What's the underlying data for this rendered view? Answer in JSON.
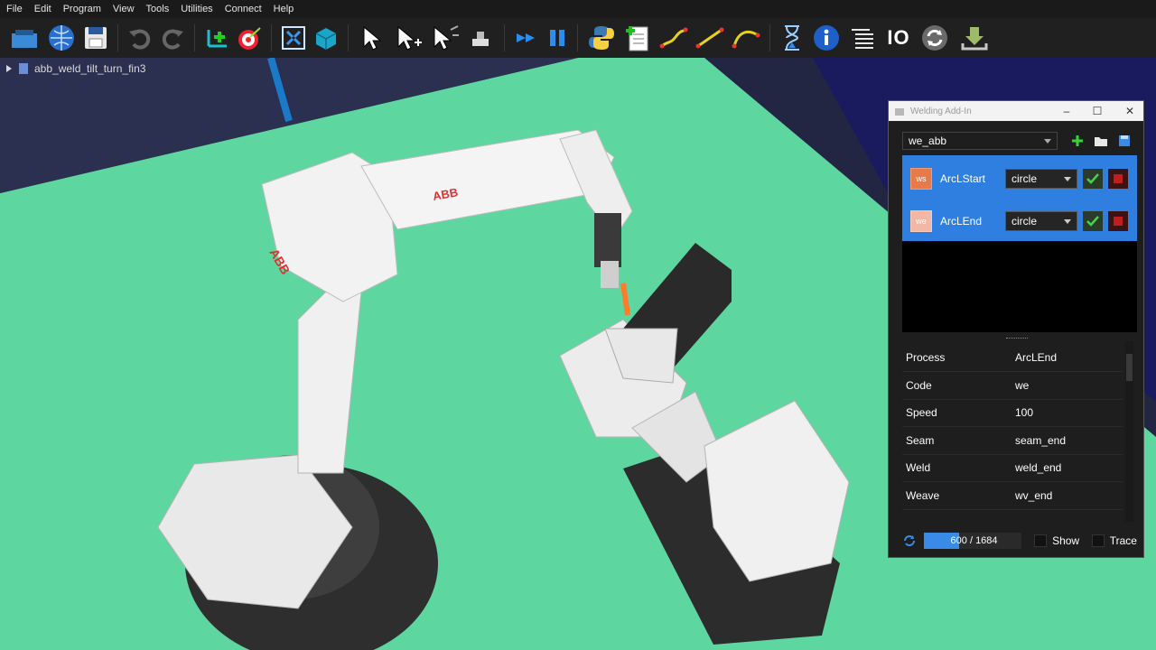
{
  "menu": [
    "File",
    "Edit",
    "Program",
    "View",
    "Tools",
    "Utilities",
    "Connect",
    "Help"
  ],
  "toolbar": {
    "io_label": "IO",
    "icons": [
      "open-station-icon",
      "globe-icon",
      "save-icon",
      "undo-icon",
      "redo-icon",
      "add-frame-icon",
      "target-icon",
      "fit-view-icon",
      "cube-icon",
      "select-icon",
      "select-add-icon",
      "select-move-icon",
      "place-icon",
      "run-icon",
      "pause-icon",
      "python-icon",
      "new-program-icon",
      "path-1-icon",
      "path-2-icon",
      "path-3-icon",
      "hourglass-icon",
      "info-icon",
      "list-icon",
      "io-icon",
      "sync-icon",
      "export-icon"
    ]
  },
  "tree": {
    "item": "abb_weld_tilt_turn_fin3"
  },
  "panel": {
    "title": "Welding Add-In",
    "process_select": "we_abb",
    "rows": [
      {
        "badge": "ws",
        "label": "ArcLStart",
        "combo": "circle",
        "badge_color": "#e87a4a"
      },
      {
        "badge": "we",
        "label": "ArcLEnd",
        "combo": "circle",
        "badge_color": "#f3b7a6"
      }
    ],
    "props": [
      {
        "key": "Process",
        "value": "ArcLEnd"
      },
      {
        "key": "Code",
        "value": "we"
      },
      {
        "key": "Speed",
        "value": "100"
      },
      {
        "key": "Seam",
        "value": "seam_end"
      },
      {
        "key": "Weld",
        "value": "weld_end"
      },
      {
        "key": "Weave",
        "value": "wv_end"
      }
    ],
    "progress_current": "600",
    "progress_total": "1684",
    "progress_text": "600 / 1684",
    "progress_fraction": 0.36,
    "show_label": "Show",
    "trace_label": "Trace"
  },
  "colors": {
    "floor": "#5ed6a0",
    "accent": "#2f7fe0",
    "sky": "#1c1f3a"
  }
}
